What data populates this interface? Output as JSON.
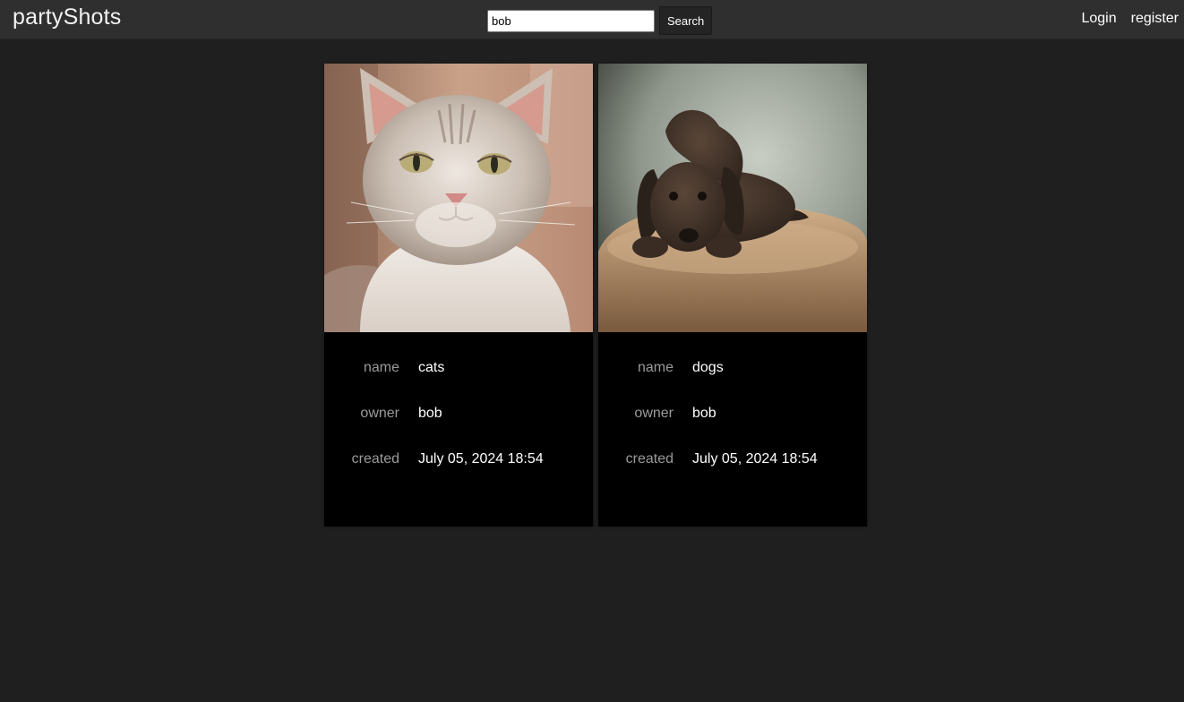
{
  "header": {
    "brand": "partyShots",
    "search": {
      "value": "bob",
      "button_label": "Search"
    },
    "links": {
      "login": "Login",
      "register": "register"
    }
  },
  "cards": [
    {
      "image_subject": "cat",
      "labels": {
        "name": "name",
        "owner": "owner",
        "created": "created"
      },
      "values": {
        "name": "cats",
        "owner": "bob",
        "created": "July 05, 2024 18:54"
      }
    },
    {
      "image_subject": "dog",
      "labels": {
        "name": "name",
        "owner": "owner",
        "created": "created"
      },
      "values": {
        "name": "dogs",
        "owner": "bob",
        "created": "July 05, 2024 18:54"
      }
    }
  ],
  "colors": {
    "background": "#1f1f1f",
    "topbar": "#2f2f2f",
    "card": "#000000",
    "label": "#9a9a9a",
    "text": "#ffffff"
  }
}
